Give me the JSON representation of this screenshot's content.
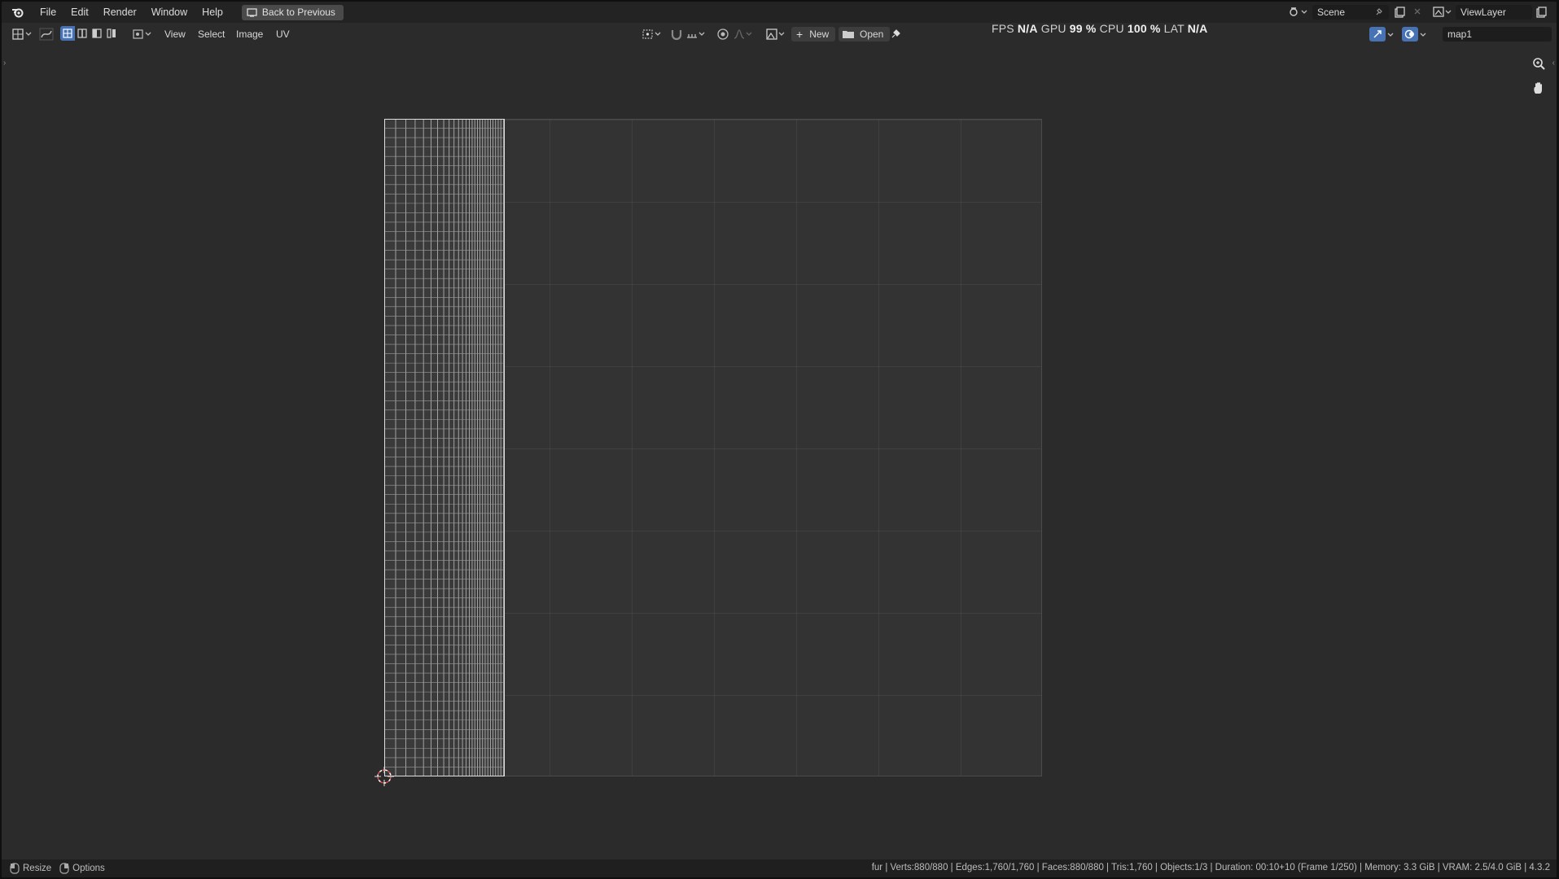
{
  "topbar": {
    "menus": [
      "File",
      "Edit",
      "Render",
      "Window",
      "Help"
    ],
    "back_button": "Back to Previous",
    "scene": "Scene",
    "view_layer": "ViewLayer"
  },
  "header": {
    "menus": [
      "View",
      "Select",
      "Image",
      "UV"
    ],
    "new_label": "New",
    "open_label": "Open",
    "image_name": "map1"
  },
  "stats": {
    "fps_label": "FPS",
    "fps_value": "N/A",
    "gpu_label": "GPU",
    "gpu_value": "99 %",
    "cpu_label": "CPU",
    "cpu_value": "100 %",
    "lat_label": "LAT",
    "lat_value": "N/A"
  },
  "statusbar": {
    "resize": "Resize",
    "options": "Options",
    "info": "fur | Verts:880/880 | Edges:1,760/1,760 | Faces:880/880 | Tris:1,760 | Objects:1/3 | Duration: 00:10+10 (Frame 1/250) | Memory: 3.3 GiB | VRAM: 2.5/4.0 GiB | 4.3.2"
  },
  "icons": {
    "logo": "blender-logo-icon",
    "zoom": "zoom-icon",
    "pan": "hand-pan-icon",
    "cursor": "3d-cursor-icon"
  }
}
